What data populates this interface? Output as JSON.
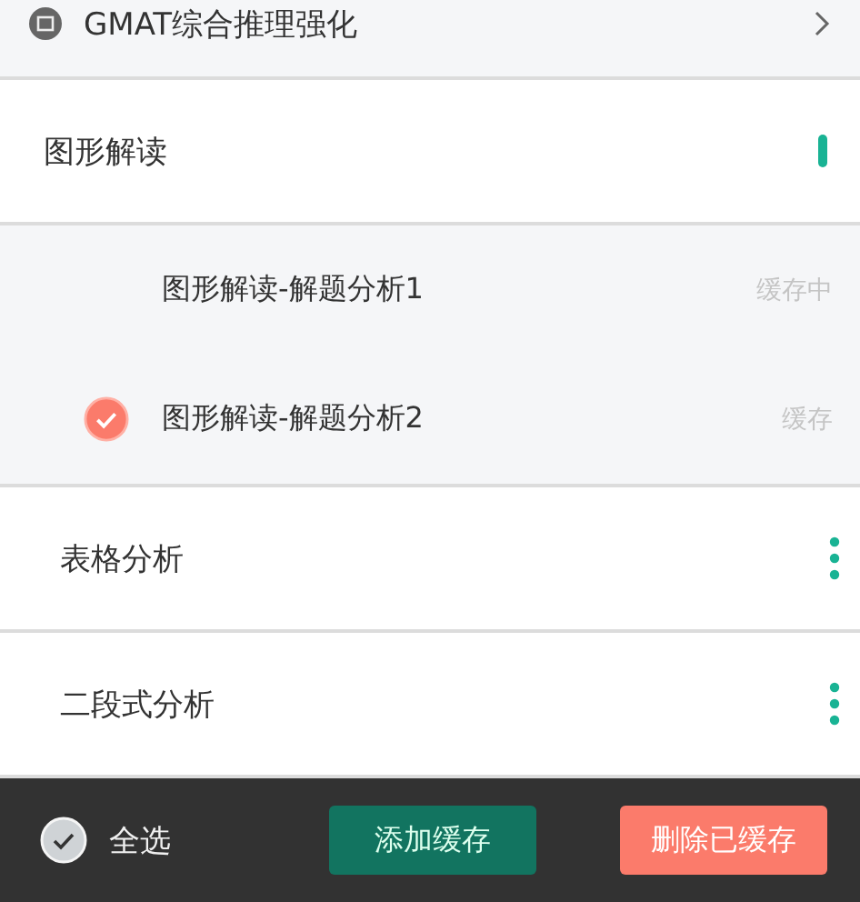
{
  "header": {
    "title": "GMAT综合推理强化"
  },
  "sections": [
    {
      "title": "图形解读",
      "expanded": true,
      "children": [
        {
          "title": "图形解读-解题分析1",
          "checked": false,
          "status": "缓存中"
        },
        {
          "title": "图形解读-解题分析2",
          "checked": true,
          "status": "缓存"
        }
      ]
    },
    {
      "title": "表格分析",
      "expanded": false
    },
    {
      "title": "二段式分析",
      "expanded": false
    }
  ],
  "footer": {
    "select_all": {
      "label": "全选",
      "checked": false
    },
    "buttons": [
      {
        "label": "添加缓存",
        "kind": "primary"
      },
      {
        "label": "删除已缓存",
        "kind": "danger"
      }
    ]
  }
}
